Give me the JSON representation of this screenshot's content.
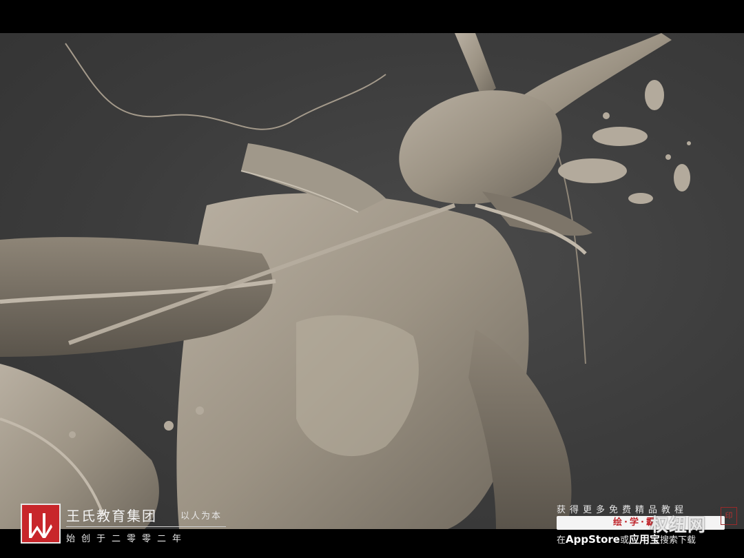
{
  "scene": {
    "background_color": "#3a3a3a",
    "clay_color": "#a39a8c",
    "subject": "dragon-sculpt"
  },
  "brand": {
    "name": "王氏教育集团",
    "slogan": "以人为本",
    "founded": "始创于二零零二年",
    "logo_letters": "W",
    "accent": "#c8262b"
  },
  "promo": {
    "title": "获得更多免费精品教程",
    "app_name": "绘·学·霸",
    "watermark": "权纽网",
    "search_prefix": "在",
    "store_name": "AppStore",
    "search_or": "或",
    "alt_store": "应用宝",
    "search_suffix": "搜索下载"
  }
}
